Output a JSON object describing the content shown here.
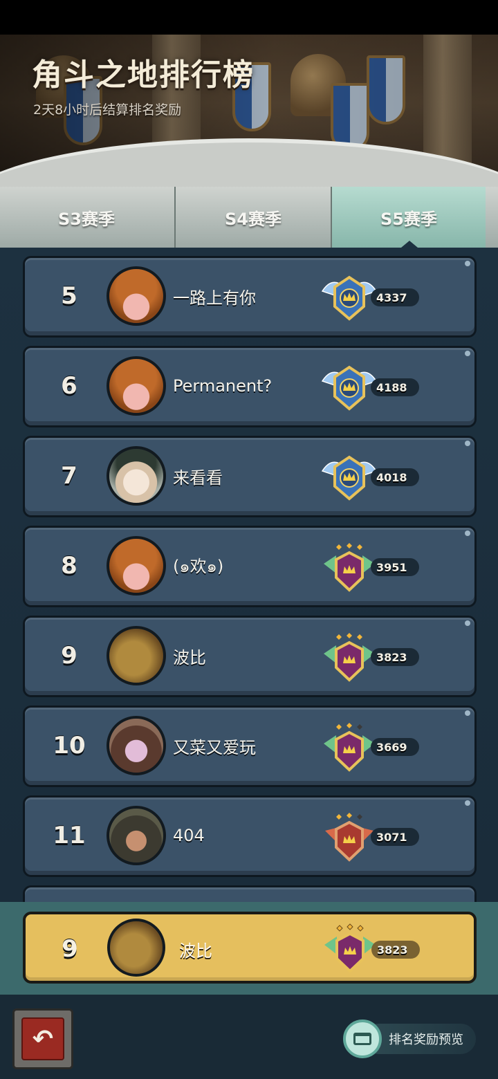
{
  "header": {
    "title": "角斗之地排行榜",
    "subtitle": "2天8小时后结算排名奖励"
  },
  "tabs": [
    {
      "label": "S3赛季",
      "selected": false
    },
    {
      "label": "S4赛季",
      "selected": false
    },
    {
      "label": "S5赛季",
      "selected": true
    }
  ],
  "leaderboard": [
    {
      "rank": "5",
      "name": "一路上有你",
      "score": "4337",
      "avatar": "pumpkin-avatar",
      "badge": "winged-crown-badge-icon"
    },
    {
      "rank": "6",
      "name": "Permanent?",
      "score": "4188",
      "avatar": "pumpkin-avatar",
      "badge": "winged-crown-badge-icon"
    },
    {
      "rank": "7",
      "name": "来看看",
      "score": "4018",
      "avatar": "hat-avatar",
      "badge": "winged-crown-badge-icon"
    },
    {
      "rank": "8",
      "name": "(๑欢๑)",
      "score": "3951",
      "avatar": "pumpkin-avatar",
      "badge": "three-star-crest-badge-icon"
    },
    {
      "rank": "9",
      "name": "波比",
      "score": "3823",
      "avatar": "mask-avatar",
      "badge": "three-star-crest-badge-icon"
    },
    {
      "rank": "10",
      "name": "又菜又爱玩",
      "score": "3669",
      "avatar": "cat-avatar",
      "badge": "two-star-crest-badge-icon"
    },
    {
      "rank": "11",
      "name": "404",
      "score": "3071",
      "avatar": "goggle-avatar",
      "badge": "two-star-red-crest-badge-icon"
    }
  ],
  "my_rank": {
    "rank": "9",
    "name": "波比",
    "score": "3823"
  },
  "bottom": {
    "reward_preview_label": "排名奖励预览"
  },
  "colors": {
    "row_bg": "#3b5268",
    "my_row_bg": "#e5bf5e",
    "selected_tab": "#87b6aa"
  }
}
